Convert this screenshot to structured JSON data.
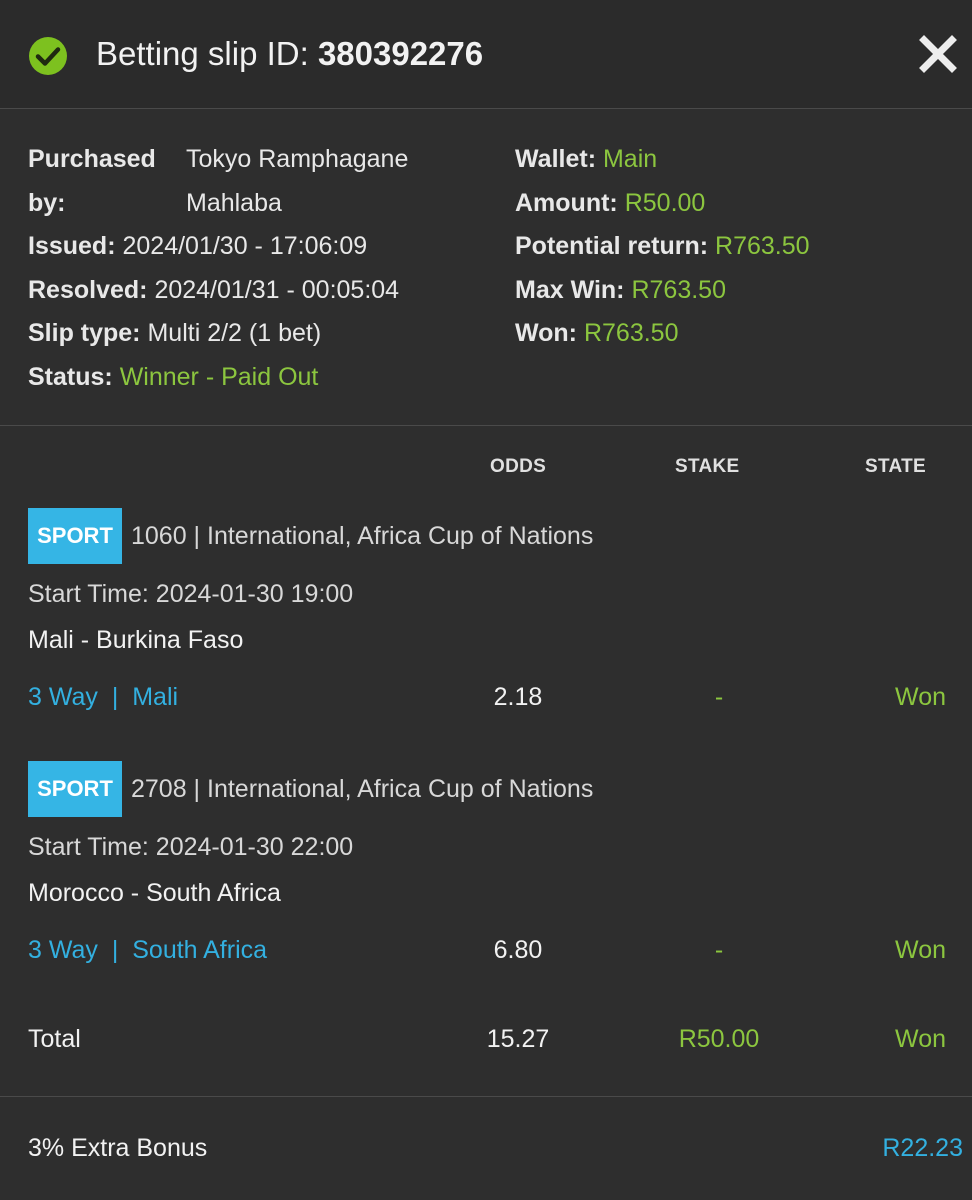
{
  "header": {
    "title_prefix": "Betting slip ID: ",
    "slip_id": "380392276"
  },
  "info": {
    "purchased_label": "Purchased",
    "purchased_label2": "by:",
    "purchased_by_line1": "Tokyo Ramphagane",
    "purchased_by_line2": "Mahlaba",
    "issued_label": "Issued:",
    "issued": "2024/01/30 - 17:06:09",
    "resolved_label": "Resolved:",
    "resolved": "2024/01/31 - 00:05:04",
    "slip_type_label": "Slip type:",
    "slip_type": "Multi 2/2 (1 bet)",
    "status_label": "Status:",
    "status": "Winner - Paid Out",
    "wallet_label": "Wallet:",
    "wallet": "Main",
    "amount_label": "Amount:",
    "amount": "R50.00",
    "potential_label": "Potential return:",
    "potential": "R763.50",
    "maxwin_label": "Max Win:",
    "maxwin": "R763.50",
    "won_label": "Won:",
    "won": "R763.50"
  },
  "columns": {
    "odds": "ODDS",
    "stake": "STAKE",
    "state": "STATE"
  },
  "bets": [
    {
      "badge": "SPORT",
      "event": "1060 | International, Africa Cup of Nations",
      "start": "Start Time: 2024-01-30 19:00",
      "match": "Mali - Burkina Faso",
      "market": "3 Way",
      "sep": "|",
      "selection": "Mali",
      "odds": "2.18",
      "stake": "-",
      "state": "Won"
    },
    {
      "badge": "SPORT",
      "event": "2708 | International, Africa Cup of Nations",
      "start": "Start Time: 2024-01-30 22:00",
      "match": "Morocco - South Africa",
      "market": "3 Way",
      "sep": "|",
      "selection": "South Africa",
      "odds": "6.80",
      "stake": "-",
      "state": "Won"
    }
  ],
  "total": {
    "label": "Total",
    "odds": "15.27",
    "stake": "R50.00",
    "state": "Won"
  },
  "bonus": {
    "label": "3% Extra Bonus",
    "value": "R22.23"
  },
  "colors": {
    "accent_green": "#8cc63f",
    "accent_blue": "#33b0e0",
    "badge_blue": "#35b5e5",
    "background": "#2e2e2e"
  }
}
